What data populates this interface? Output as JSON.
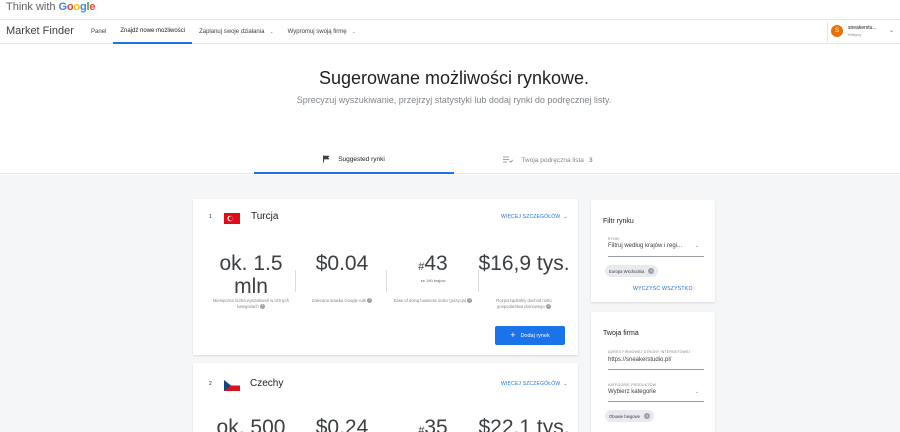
{
  "brand": {
    "prefix": "Think with",
    "google": "Google"
  },
  "header": {
    "app_title": "Market Finder",
    "nav": [
      {
        "label": "Panel"
      },
      {
        "label": "Znajdź nowe możliwości"
      },
      {
        "label": "Zaplanuj swoje działania"
      },
      {
        "label": "Wypromuj swoją firmę"
      }
    ],
    "account": {
      "initial": "S",
      "name": "sneakerstu...",
      "subtitle": "Witryny"
    }
  },
  "hero": {
    "title": "Sugerowane możliwości rynkowe.",
    "subtitle": "Sprecyzuj wyszukiwanie, przejrzyj statystyki lub dodaj rynki do podręcznej listy."
  },
  "tabs": {
    "suggested": "Suggested rynki",
    "shortlist": "Twoja podręczna lista",
    "shortlist_count": "3"
  },
  "markets": [
    {
      "rank": "1",
      "country": "Turcja",
      "details_label": "WIĘCEJ SZCZEGÓŁÓW",
      "stats": [
        {
          "value": "ok. 1.5 mln",
          "desc": "Miesięczna liczba wyszukiwań w różnych kategoriach"
        },
        {
          "value": "$0.04",
          "desc": "Zalecana stawka Google Ads"
        },
        {
          "hash": "#",
          "value": "43",
          "sub": "ze 190 krajów",
          "desc": "Ease of doing business index (pozycja)"
        },
        {
          "value": "$16,9 tys.",
          "desc": "Rozporządzalny dochód netto gospodarstwa domowego"
        }
      ],
      "add_label": "Dodaj rynek"
    },
    {
      "rank": "2",
      "country": "Czechy",
      "details_label": "WIĘCEJ SZCZEGÓŁÓW",
      "stats": [
        {
          "value": "ok. 500"
        },
        {
          "value": "$0.24"
        },
        {
          "hash": "#",
          "value": "35"
        },
        {
          "value": "$22,1 tys."
        }
      ]
    }
  ],
  "market_filter": {
    "title": "Filtr rynku",
    "field_label": "RYNKI",
    "field_value": "Filtruj według krajów i regi...",
    "chip": "Europa Wschodnia",
    "clear_label": "WYCZYŚĆ WSZYSTKO"
  },
  "business": {
    "title": "Twoja firma",
    "site_label": "ADRES FIRMOWEJ STRONY INTERNETOWEJ",
    "site_value": "https://sneakerstudio.pl/",
    "category_label": "KATEGORIE PRODUKTÓW",
    "category_value": "Wybierz kategorie",
    "chip": "Obuwie biegowe"
  }
}
